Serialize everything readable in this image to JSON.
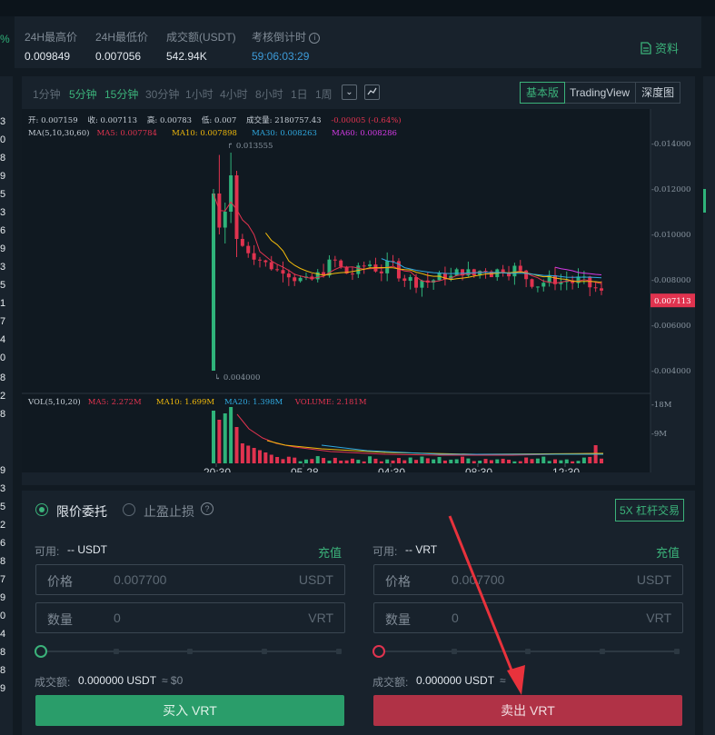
{
  "header": {
    "change_fragment": "%",
    "stats": [
      {
        "label": "24H最高价",
        "value": "0.009849"
      },
      {
        "label": "24H最低价",
        "value": "0.007056"
      },
      {
        "label": "成交额(USDT)",
        "value": "542.94K"
      },
      {
        "label": "考核倒计时",
        "value": "59:06:03:29"
      }
    ],
    "doc_link": "资料"
  },
  "left_numbers": [
    "3",
    "0",
    "8",
    "9",
    "5",
    "3",
    "6",
    "9",
    "3",
    "5",
    "1",
    "7",
    "4",
    "0",
    "8",
    "2",
    "8",
    "9",
    "3",
    "5",
    "2",
    "6",
    "8",
    "7",
    "9",
    "0",
    "4",
    "8",
    "8",
    "9"
  ],
  "chart": {
    "timeframes": [
      "1分钟",
      "5分钟",
      "15分钟",
      "30分钟",
      "1小时",
      "4小时",
      "8小时",
      "1日",
      "1周"
    ],
    "active_timeframes": [
      "5分钟",
      "15分钟"
    ],
    "views": [
      "基本版",
      "TradingView",
      "深度图"
    ],
    "active_view": "基本版",
    "ohlc": {
      "open": "开: 0.007159",
      "close": "收: 0.007113",
      "high": "高: 0.00783",
      "low": "低: 0.007",
      "volume": "成交量: 2180757.43",
      "change": "-0.00005 (-0.64%)"
    },
    "ma": {
      "label": "MA(5,10,30,60)",
      "ma5": "MA5: 0.007784",
      "ma10": "MA10: 0.007898",
      "ma30": "MA30: 0.008263",
      "ma60": "MA60: 0.008286"
    },
    "vol": {
      "label": "VOL(5,10,20)",
      "ma5": "MA5: 2.272M",
      "ma10": "MA10: 1.699M",
      "ma20": "MA20: 1.398M",
      "volume": "VOLUME: 2.181M"
    },
    "price_axis": [
      "-0.014000",
      "-0.012000",
      "-0.010000",
      "-0.008000",
      "-0.006000",
      "-0.004000"
    ],
    "volume_axis": [
      "-18M",
      "-9M"
    ],
    "current_price": "0.007113",
    "high_marker": "0.013555",
    "low_marker": "0.004000",
    "time_axis": [
      "20:30",
      "05-28",
      "04:30",
      "08:30",
      "12:30"
    ],
    "colors": {
      "up": "#2fb37a",
      "down": "#e0334f",
      "ma5": "#e0334f",
      "ma10": "#f0b90b",
      "ma30": "#2fa9e0",
      "ma60": "#d63ae8"
    }
  },
  "order": {
    "tabs": {
      "limit": "限价委托",
      "stop": "止盈止损"
    },
    "leverage": "5X 杠杆交易",
    "buy": {
      "avail_label": "可用:",
      "avail_value": "-- USDT",
      "recharge": "充值",
      "price_label": "价格",
      "price_value": "0.007700",
      "price_unit": "USDT",
      "qty_label": "数量",
      "qty_value": "0",
      "qty_unit": "VRT",
      "amount_label": "成交额:",
      "amount_value": "0.000000 USDT",
      "amount_approx": "≈ $0",
      "button": "买入 VRT"
    },
    "sell": {
      "avail_label": "可用:",
      "avail_value": "-- VRT",
      "recharge": "充值",
      "price_label": "价格",
      "price_value": "0.007700",
      "price_unit": "USDT",
      "qty_label": "数量",
      "qty_value": "0",
      "qty_unit": "VRT",
      "amount_label": "成交额:",
      "amount_value": "0.000000 USDT",
      "amount_approx": "≈",
      "button": "卖出 VRT"
    }
  }
}
